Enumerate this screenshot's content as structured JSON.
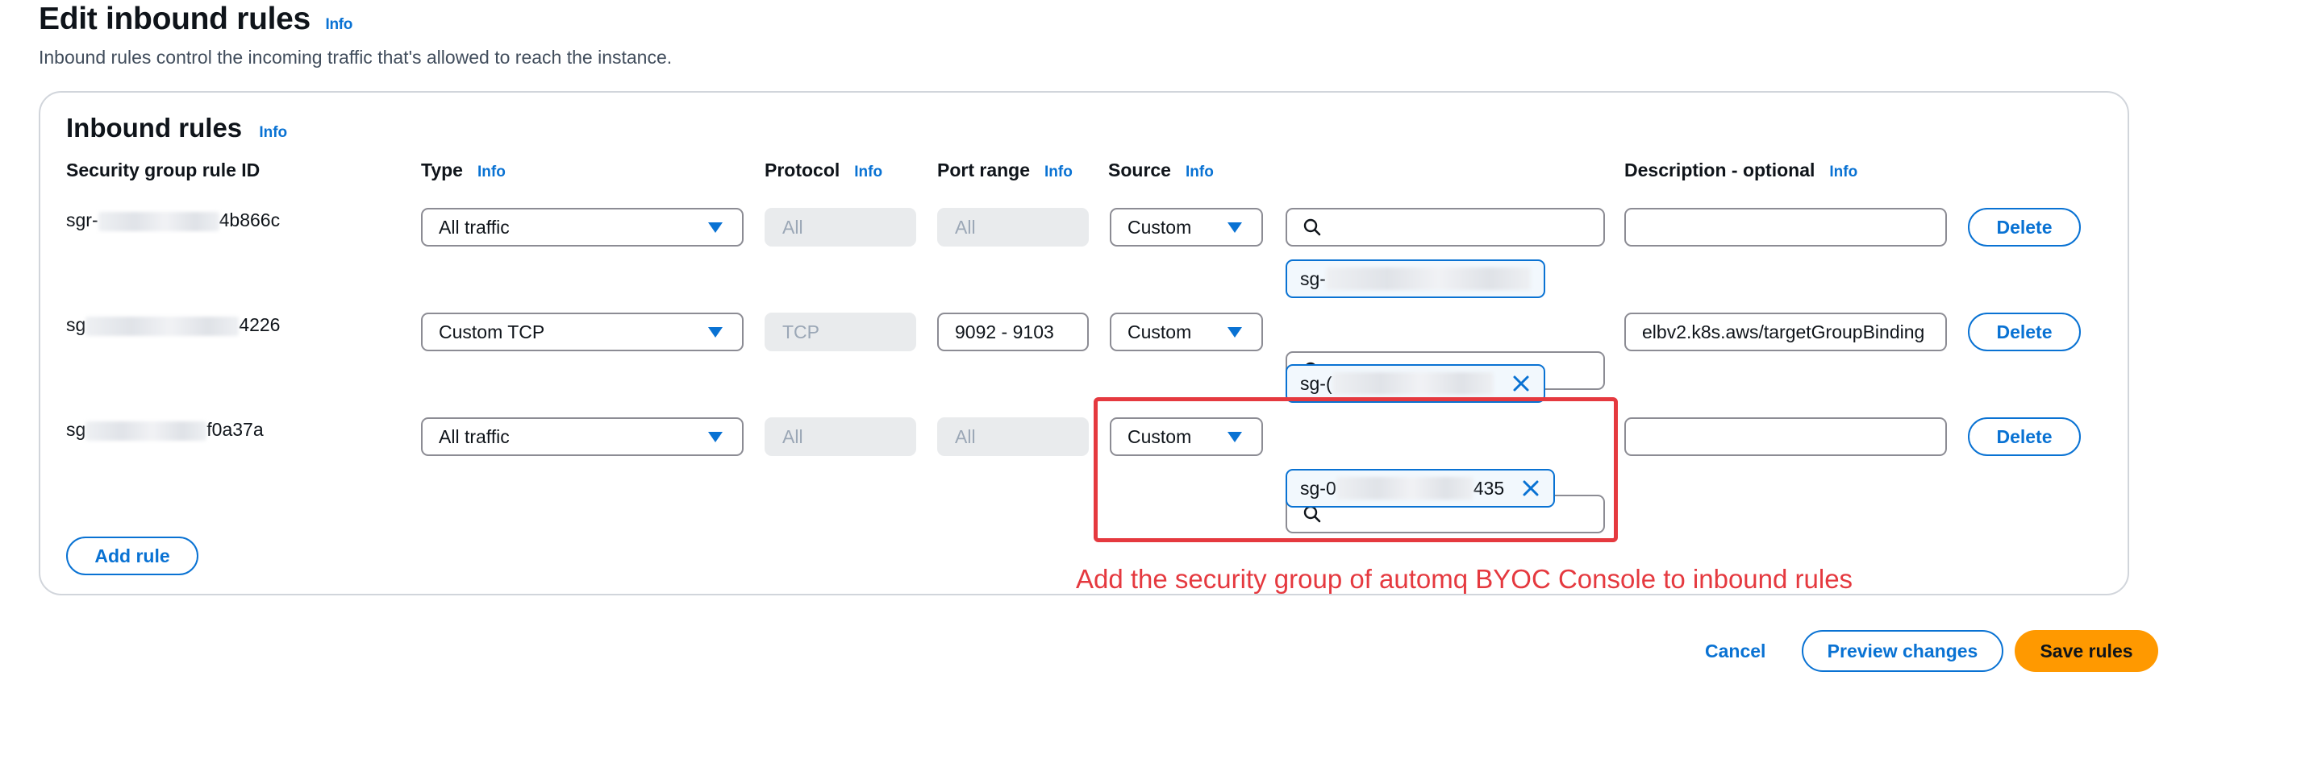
{
  "page": {
    "title": "Edit inbound rules",
    "info": "Info",
    "description": "Inbound rules control the incoming traffic that's allowed to reach the instance."
  },
  "panel": {
    "title": "Inbound rules",
    "info": "Info",
    "headers": {
      "rule_id": "Security group rule ID",
      "type": "Type",
      "protocol": "Protocol",
      "port_range": "Port range",
      "source": "Source",
      "description": "Description - optional",
      "info": "Info"
    }
  },
  "rules": [
    {
      "id_prefix": "sgr-",
      "id_suffix": "4b866c",
      "type": "All traffic",
      "protocol": "All",
      "port_range": "All",
      "source": "Custom",
      "source_search": "",
      "token_prefix": "sg-",
      "token_suffix": "",
      "description": "",
      "delete": "Delete"
    },
    {
      "id_prefix": "sg",
      "id_suffix": "4226",
      "type": "Custom TCP",
      "protocol": "TCP",
      "port_range": "9092 - 9103",
      "source": "Custom",
      "source_search": "",
      "token_prefix": "sg-(",
      "token_suffix": "",
      "description": "elbv2.k8s.aws/targetGroupBinding",
      "delete": "Delete"
    },
    {
      "id_prefix": "sg",
      "id_suffix": "f0a37a",
      "type": "All traffic",
      "protocol": "All",
      "port_range": "All",
      "source": "Custom",
      "source_search": "",
      "token_prefix": "sg-0",
      "token_suffix": "435",
      "description": "",
      "delete": "Delete"
    }
  ],
  "add_rule": "Add rule",
  "annotation": "Add the security group of automq BYOC Console to inbound rules",
  "footer": {
    "cancel": "Cancel",
    "preview": "Preview changes",
    "save": "Save rules"
  },
  "colors": {
    "link": "#0972d3",
    "primary": "#ff9900",
    "annotation": "#e5393f",
    "disabled_bg": "#e9ebed"
  },
  "icons": {
    "caret": "caret-down-icon",
    "search": "search-icon",
    "dismiss": "close-icon"
  }
}
